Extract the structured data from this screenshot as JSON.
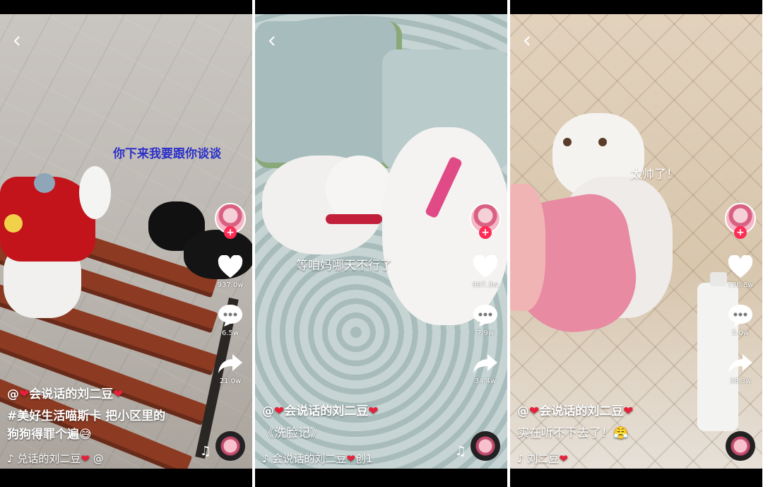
{
  "panels": [
    {
      "overlay_text": "你下来我要跟你谈谈",
      "likes": "937.0w",
      "comments": "6.5w",
      "shares": "21.0w",
      "username": "@",
      "username_name": "会说话的刘二豆",
      "hashtag": "#美好生活喵斯卡",
      "desc_line1": " 把小区里的",
      "desc_line2": "狗狗得罪个遍😅",
      "music": "♪ 兑话的刘二豆",
      "music_tail": " @"
    },
    {
      "overlay_text": "等咱妈哪天不行了",
      "likes": "907.3w",
      "comments": "7.9w",
      "shares": "34.4w",
      "username": "@",
      "username_name": "会说话的刘二豆",
      "title": "《洗脸记》",
      "music": "♪ 会说话的刘二豆",
      "music_tail": "创1"
    },
    {
      "overlay_text": "太帅了！",
      "likes": "736.8w",
      "comments": "5.0w",
      "shares": "38.3w",
      "username": "@",
      "username_name": "会说话的刘二豆",
      "desc": "实在听不下去了！😤",
      "music": "♪ 刘二豆"
    }
  ],
  "icons": {
    "back": "chevron-left-icon",
    "like": "heart-icon",
    "comment": "comment-icon",
    "share": "share-icon",
    "music": "music-note-icon",
    "follow": "plus-icon"
  },
  "colors": {
    "accent": "#fe2c55",
    "heart_inline": "#e7203a",
    "overlay_blue": "#2a2fc8",
    "overlay_light": "#ffffff"
  },
  "follow_symbol": "+",
  "heart_symbol": "❤"
}
